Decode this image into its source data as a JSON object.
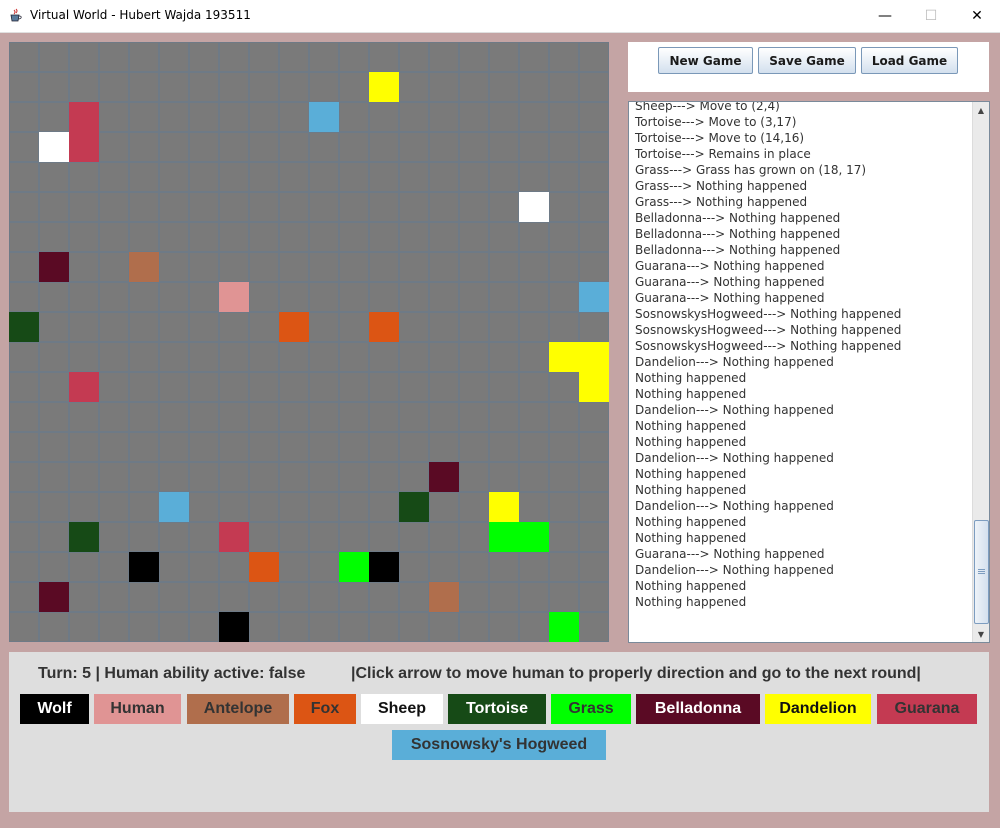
{
  "window": {
    "title": "Virtual World - Hubert Wajda 193511",
    "min_glyph": "—",
    "max_glyph": "☐",
    "close_glyph": "✕"
  },
  "toolbar": {
    "new_game": "New Game",
    "save_game": "Save Game",
    "load_game": "Load Game"
  },
  "log": {
    "lines": [
      "Sheep--->   Move to (2,4)",
      "Tortoise--->   Move to (3,17)",
      "Tortoise--->   Move to (14,16)",
      "Tortoise--->   Remains in place",
      "Grass--->   Grass has grown on (18, 17)",
      "Grass--->   Nothing happened",
      "Grass--->   Nothing happened",
      "Belladonna--->   Nothing happened",
      "Belladonna--->   Nothing happened",
      "Belladonna--->   Nothing happened",
      "Guarana--->   Nothing happened",
      "Guarana--->   Nothing happened",
      "Guarana--->   Nothing happened",
      "SosnowskysHogweed--->   Nothing happened",
      "SosnowskysHogweed--->   Nothing happened",
      "SosnowskysHogweed--->   Nothing happened",
      "Dandelion--->   Nothing happened",
      "Nothing happened",
      "Nothing happened",
      "Dandelion--->   Nothing happened",
      "Nothing happened",
      "Nothing happened",
      "Dandelion--->   Nothing happened",
      "Nothing happened",
      "Nothing happened",
      "Dandelion--->   Nothing happened",
      "Nothing happened",
      "Nothing happened",
      "Guarana--->   Nothing happened",
      "Dandelion--->   Nothing happened",
      "Nothing happened",
      "Nothing happened"
    ]
  },
  "status": {
    "turn_text": "Turn: 5 |  Human ability active: false",
    "hint_text": "|Click arrow to move human to properly direction and go to the next round|"
  },
  "organisms": {
    "Wolf": {
      "bg": "#000000",
      "fg": "#ffffff"
    },
    "Human": {
      "bg": "#e09494",
      "fg": "#333333"
    },
    "Antelope": {
      "bg": "#b06e4c",
      "fg": "#333333"
    },
    "Fox": {
      "bg": "#dc5514",
      "fg": "#333333"
    },
    "Sheep": {
      "bg": "#ffffff",
      "fg": "#111111"
    },
    "Tortoise": {
      "bg": "#164a16",
      "fg": "#ffffff"
    },
    "Grass": {
      "bg": "#00ff00",
      "fg": "#333333"
    },
    "Belladonna": {
      "bg": "#5a0a24",
      "fg": "#ffffff"
    },
    "Dandelion": {
      "bg": "#ffff00",
      "fg": "#111111"
    },
    "Guarana": {
      "bg": "#c43a52",
      "fg": "#333333"
    },
    "Hogweed": {
      "bg": "#5aaed8",
      "fg": "#333333"
    }
  },
  "legend": [
    {
      "key": "Wolf",
      "label": "Wolf"
    },
    {
      "key": "Human",
      "label": "Human"
    },
    {
      "key": "Antelope",
      "label": "Antelope"
    },
    {
      "key": "Fox",
      "label": "Fox"
    },
    {
      "key": "Sheep",
      "label": "Sheep"
    },
    {
      "key": "Tortoise",
      "label": "Tortoise"
    },
    {
      "key": "Grass",
      "label": "Grass"
    },
    {
      "key": "Belladonna",
      "label": "Belladonna"
    },
    {
      "key": "Dandelion",
      "label": "Dandelion"
    },
    {
      "key": "Guarana",
      "label": "Guarana"
    },
    {
      "key": "Hogweed",
      "label": "Sosnowsky's Hogweed"
    }
  ],
  "board": {
    "columns": 20,
    "rows": 20,
    "empty_color": "#7a7a7a",
    "grid_color": "#6e7a86",
    "cells": [
      {
        "col": 12,
        "row": 1,
        "key": "Dandelion"
      },
      {
        "col": 2,
        "row": 2,
        "key": "Guarana"
      },
      {
        "col": 10,
        "row": 2,
        "key": "Hogweed"
      },
      {
        "col": 1,
        "row": 3,
        "key": "Sheep"
      },
      {
        "col": 2,
        "row": 3,
        "key": "Guarana"
      },
      {
        "col": 17,
        "row": 5,
        "key": "Sheep"
      },
      {
        "col": 1,
        "row": 7,
        "key": "Belladonna"
      },
      {
        "col": 4,
        "row": 7,
        "key": "Antelope"
      },
      {
        "col": 7,
        "row": 8,
        "key": "Human"
      },
      {
        "col": 19,
        "row": 8,
        "key": "Hogweed"
      },
      {
        "col": 0,
        "row": 9,
        "key": "Tortoise"
      },
      {
        "col": 9,
        "row": 9,
        "key": "Fox"
      },
      {
        "col": 12,
        "row": 9,
        "key": "Fox"
      },
      {
        "col": 18,
        "row": 10,
        "key": "Dandelion"
      },
      {
        "col": 19,
        "row": 10,
        "key": "Dandelion"
      },
      {
        "col": 2,
        "row": 11,
        "key": "Guarana"
      },
      {
        "col": 19,
        "row": 11,
        "key": "Dandelion"
      },
      {
        "col": 14,
        "row": 14,
        "key": "Belladonna"
      },
      {
        "col": 5,
        "row": 15,
        "key": "Hogweed"
      },
      {
        "col": 13,
        "row": 15,
        "key": "Tortoise"
      },
      {
        "col": 16,
        "row": 15,
        "key": "Dandelion"
      },
      {
        "col": 2,
        "row": 16,
        "key": "Tortoise"
      },
      {
        "col": 7,
        "row": 16,
        "key": "Guarana"
      },
      {
        "col": 16,
        "row": 16,
        "key": "Grass"
      },
      {
        "col": 17,
        "row": 16,
        "key": "Grass"
      },
      {
        "col": 4,
        "row": 17,
        "key": "Wolf"
      },
      {
        "col": 8,
        "row": 17,
        "key": "Fox"
      },
      {
        "col": 11,
        "row": 17,
        "key": "Grass"
      },
      {
        "col": 12,
        "row": 17,
        "key": "Wolf"
      },
      {
        "col": 1,
        "row": 18,
        "key": "Belladonna"
      },
      {
        "col": 14,
        "row": 18,
        "key": "Antelope"
      },
      {
        "col": 7,
        "row": 19,
        "key": "Wolf"
      },
      {
        "col": 18,
        "row": 19,
        "key": "Grass"
      }
    ]
  },
  "icons": {
    "app": "java-cup-icon",
    "scroll_up": "scroll-up-arrow-icon",
    "scroll_down": "scroll-down-arrow-icon",
    "scroll_up_glyph": "▲",
    "scroll_down_glyph": "▼"
  }
}
